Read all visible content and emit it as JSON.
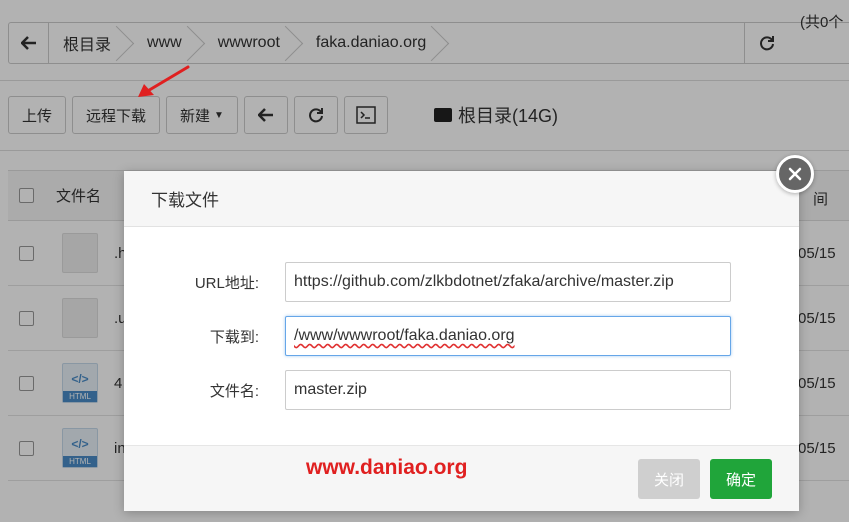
{
  "pathbar": {
    "crumbs": [
      "根目录",
      "www",
      "wwwroot",
      "faka.daniao.org"
    ],
    "total": "(共0个"
  },
  "toolbar": {
    "upload": "上传",
    "remote_download": "远程下载",
    "new": "新建",
    "disk_label": "根目录(14G)"
  },
  "table": {
    "header_name": "文件名",
    "header_time": "间",
    "rows": [
      {
        "name": ".h",
        "date": "05/15",
        "icon": "file-icon"
      },
      {
        "name": ".u",
        "date": "05/15",
        "icon": "file-icon"
      },
      {
        "name": "4",
        "date": "05/15",
        "icon": "html-file-icon"
      },
      {
        "name": "in",
        "date": "05/15",
        "icon": "html-file-icon"
      }
    ]
  },
  "dialog": {
    "title": "下载文件",
    "url_label": "URL地址:",
    "url_value": "https://github.com/zlkbdotnet/zfaka/archive/master.zip",
    "dest_label": "下载到:",
    "dest_value": "/www/wwwroot/faka.daniao.org",
    "filename_label": "文件名:",
    "filename_value": "master.zip",
    "watermark": "www.daniao.org",
    "close_label": "关闭",
    "ok_label": "确定"
  },
  "colors": {
    "accent_green": "#20a53a",
    "annotation_red": "#e02020",
    "focus_blue": "#66a6e8"
  }
}
